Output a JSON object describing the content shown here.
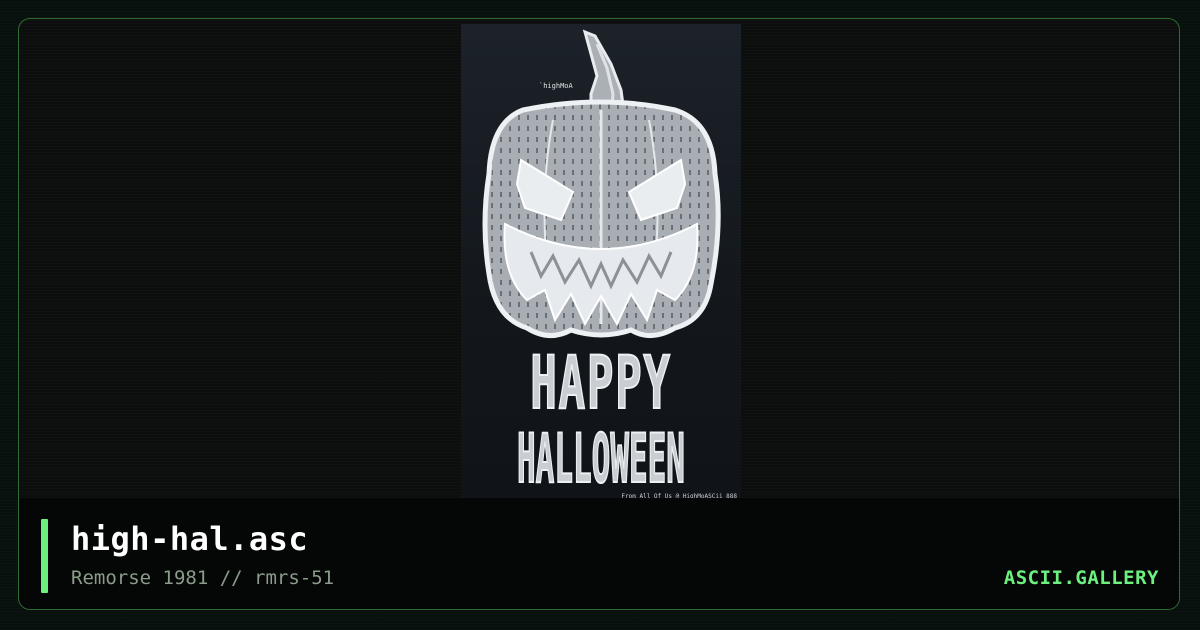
{
  "art": {
    "tag": "`highMoA",
    "line1": "HAPPY",
    "line2": "HALLOWEEN",
    "credit": "From All Of Us @ HighMoASCii 888"
  },
  "file": {
    "name": "high-hal.asc",
    "meta": "Remorse 1981 // rmrs-51"
  },
  "brand": "ASCII.GALLERY",
  "colors": {
    "accent": "#6cf07e",
    "border": "#2f6b33",
    "background": "#0b0e0c"
  }
}
